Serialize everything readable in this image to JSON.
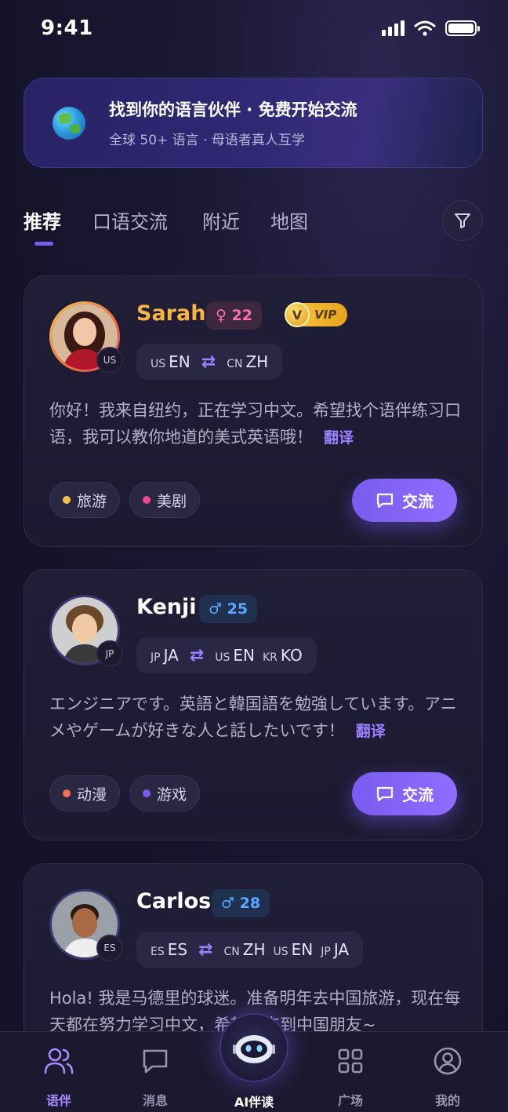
{
  "status": {
    "time": "9:41"
  },
  "banner": {
    "title": "找到你的语言伙伴 · 免费开始交流",
    "subtitle": "全球 50+ 语言 · 母语者真人互学"
  },
  "tabs": [
    "推荐",
    "口语交流",
    "附近",
    "地图"
  ],
  "cards": [
    {
      "name": "Sarah",
      "gender_age": "♀ 22",
      "vip": "VIP",
      "vip_v": "V",
      "flag": "US",
      "langs": [
        {
          "cc": "US",
          "code": "EN"
        },
        {
          "cc": "CN",
          "code": "ZH"
        }
      ],
      "bio": "你好！我来自纽约，正在学习中文。希望找个语伴练习口语，我可以教你地道的美式英语哦！",
      "translate": "翻译",
      "tags": [
        {
          "label": "旅游",
          "color": "#f5c04a"
        },
        {
          "label": "美剧",
          "color": "#ec4a8c"
        }
      ],
      "chat": "交流"
    },
    {
      "name": "Kenji",
      "gender_age": "♂ 25",
      "flag": "JP",
      "langs": [
        {
          "cc": "JP",
          "code": "JA"
        },
        {
          "cc": "US",
          "code": "EN"
        },
        {
          "cc": "KR",
          "code": "KO"
        }
      ],
      "bio": "エンジニアです。英語と韓国語を勉強しています。アニメやゲームが好きな人と話したいです！",
      "translate": "翻译",
      "tags": [
        {
          "label": "动漫",
          "color": "#f07050"
        },
        {
          "label": "游戏",
          "color": "#7a5cf0"
        }
      ],
      "chat": "交流"
    },
    {
      "name": "Carlos",
      "gender_age": "♂ 28",
      "flag": "ES",
      "langs": [
        {
          "cc": "ES",
          "code": "ES"
        },
        {
          "cc": "CN",
          "code": "ZH"
        },
        {
          "cc": "US",
          "code": "EN"
        },
        {
          "cc": "JP",
          "code": "JA"
        }
      ],
      "bio": "Hola! 我是马德里的球迷。准备明年去中国旅游，现在每天都在努力学习中文，希望能交到中国朋友~"
    }
  ],
  "nav": {
    "items": [
      "语伴",
      "消息",
      "AI伴读",
      "广场",
      "我的"
    ]
  },
  "colors": {
    "accent": "#7a5cf0",
    "female": "#ff6fa8",
    "male": "#58a8ff",
    "vip_gold": "#f7c948"
  }
}
